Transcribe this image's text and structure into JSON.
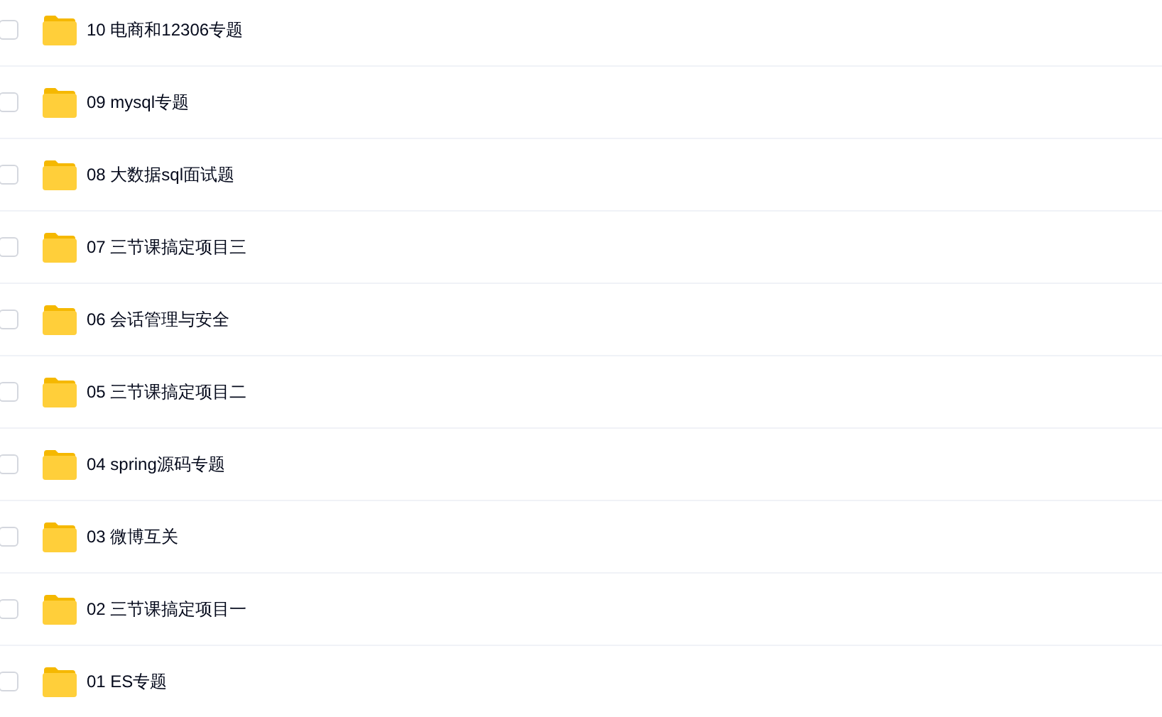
{
  "folders": [
    {
      "name": "10 电商和12306专题",
      "checked": false
    },
    {
      "name": "09 mysql专题",
      "checked": false
    },
    {
      "name": "08 大数据sql面试题",
      "checked": false
    },
    {
      "name": "07 三节课搞定项目三",
      "checked": false
    },
    {
      "name": "06 会话管理与安全",
      "checked": false
    },
    {
      "name": "05 三节课搞定项目二",
      "checked": false
    },
    {
      "name": "04 spring源码专题",
      "checked": false
    },
    {
      "name": "03 微博互关",
      "checked": false
    },
    {
      "name": "02 三节课搞定项目一",
      "checked": false
    },
    {
      "name": "01 ES专题",
      "checked": false
    }
  ]
}
